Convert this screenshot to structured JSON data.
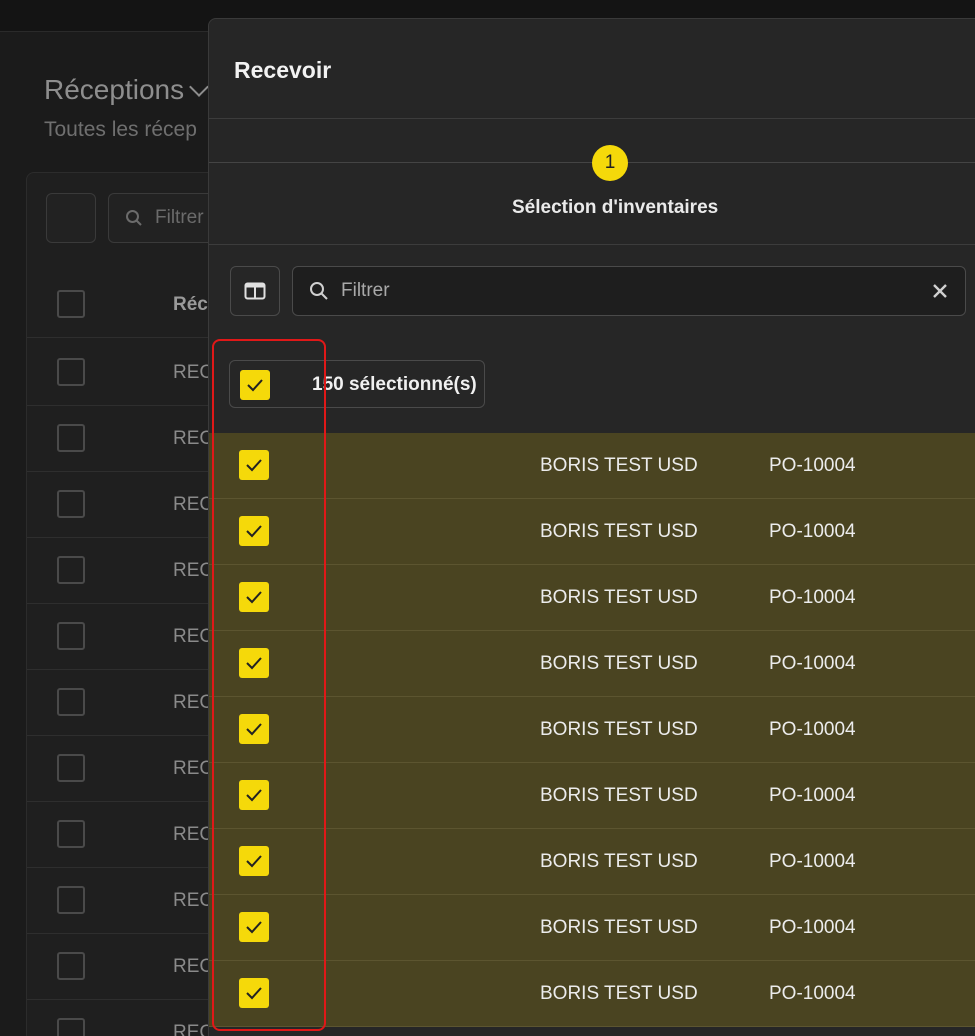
{
  "background": {
    "page_title": "Réceptions",
    "page_subtitle": "Toutes les récep",
    "filter_placeholder": "Filtrer",
    "column_header": "Réce",
    "row_labels": [
      "REC",
      "REC",
      "REC",
      "REC",
      "REC",
      "REC",
      "REC",
      "REC",
      "REC",
      "REC",
      "REC"
    ]
  },
  "modal": {
    "title": "Recevoir",
    "step": {
      "number": "1",
      "label": "Sélection d'inventaires"
    },
    "filter": {
      "placeholder": "Filtrer"
    },
    "selection": {
      "label": "150 sélectionné(s)"
    },
    "rows": [
      {
        "supplier": "BORIS TEST USD",
        "po": "PO-10004",
        "checked": true
      },
      {
        "supplier": "BORIS TEST USD",
        "po": "PO-10004",
        "checked": true
      },
      {
        "supplier": "BORIS TEST USD",
        "po": "PO-10004",
        "checked": true
      },
      {
        "supplier": "BORIS TEST USD",
        "po": "PO-10004",
        "checked": true
      },
      {
        "supplier": "BORIS TEST USD",
        "po": "PO-10004",
        "checked": true
      },
      {
        "supplier": "BORIS TEST USD",
        "po": "PO-10004",
        "checked": true
      },
      {
        "supplier": "BORIS TEST USD",
        "po": "PO-10004",
        "checked": true
      },
      {
        "supplier": "BORIS TEST USD",
        "po": "PO-10004",
        "checked": true
      },
      {
        "supplier": "BORIS TEST USD",
        "po": "PO-10004",
        "checked": true
      }
    ]
  },
  "colors": {
    "accent": "#f5d90a",
    "selected_row": "#4a4421",
    "highlight": "#e01818"
  },
  "icons": {
    "columns": "columns-icon",
    "search": "search-icon",
    "clear": "close-icon",
    "check": "checkmark-icon"
  }
}
